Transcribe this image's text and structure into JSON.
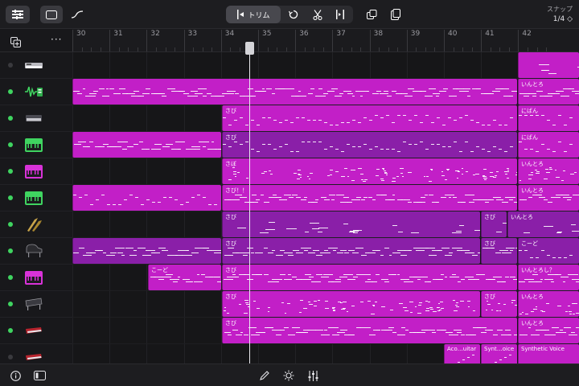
{
  "toolbar": {
    "trim_label": "トリム",
    "snap_label": "スナップ",
    "snap_value": "1/4 ◇"
  },
  "ruler": {
    "bars": [
      "30",
      "31",
      "32",
      "33",
      "34",
      "35",
      "36",
      "37",
      "38",
      "39",
      "40",
      "41",
      "42"
    ]
  },
  "colors": {
    "region_pink": "#c21fc7",
    "region_purple": "#8a1fa8",
    "accent_green": "#3fd460"
  },
  "tracks": [
    {
      "icon": "synth-keyboard-icon",
      "enabled": false
    },
    {
      "icon": "drum-machine-icon",
      "enabled": true
    },
    {
      "icon": "keyboard-icon",
      "enabled": true
    },
    {
      "icon": "green-keyboard-icon",
      "enabled": true
    },
    {
      "icon": "pink-keyboard-icon",
      "enabled": true
    },
    {
      "icon": "green-keyboard-icon",
      "enabled": true
    },
    {
      "icon": "horns-icon",
      "enabled": true
    },
    {
      "icon": "grand-piano-icon",
      "enabled": true
    },
    {
      "icon": "pink-keyboard-icon",
      "enabled": true
    },
    {
      "icon": "electric-piano-icon",
      "enabled": true
    },
    {
      "icon": "red-synth-icon",
      "enabled": true
    },
    {
      "icon": "red-synth-icon",
      "enabled": false
    }
  ],
  "regions": {
    "r0": "",
    "r1a": "",
    "r1b": "いんとろ",
    "r2a": "さび",
    "r2b": "にばん",
    "r3a": "",
    "r3b": "さび",
    "r3c": "にばん",
    "r4a": "さぼ",
    "r4b": "いんとろ",
    "r5a": "",
    "r5b": "さび！！",
    "r5c": "いんとろ",
    "r6a": "さび",
    "r6b": "さび",
    "r6c": "いんとろ",
    "r7a": "",
    "r7b": "さび",
    "r7c": "さび",
    "r7d": "こーど",
    "r8a": "こーど",
    "r8b": "さび",
    "r8c": "いんとろし？",
    "r9a": "さび",
    "r9b": "さび",
    "r9c": "いんとろ",
    "r10a": "さび",
    "r10b": "いんとろ",
    "r11a": "Aco…uitar",
    "r11b": "Synt…oice",
    "r11c": "Synthetic Voice"
  }
}
